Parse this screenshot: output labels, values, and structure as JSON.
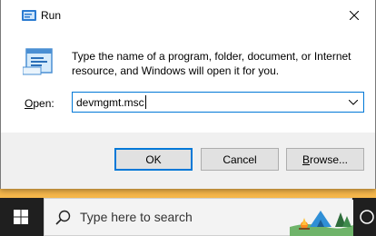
{
  "dialog": {
    "title": "Run",
    "description": "Type the name of a program, folder, document, or Internet resource, and Windows will open it for you.",
    "open_label_accel": "O",
    "open_label_rest": "pen:",
    "open_value": "devmgmt.msc",
    "ok_label": "OK",
    "cancel_label": "Cancel",
    "browse_accel": "B",
    "browse_rest": "rowse...",
    "icons": [
      "run-icon",
      "close-icon",
      "chevron-down-icon"
    ]
  },
  "taskbar": {
    "search_placeholder": "Type here to search",
    "icons": [
      "windows-start-icon",
      "search-icon",
      "search-highlight-art",
      "task-view-icon"
    ]
  },
  "colors": {
    "accent": "#0078d7",
    "taskbar": "#1f1f1f",
    "dialog_bg": "#f0f0f0"
  }
}
